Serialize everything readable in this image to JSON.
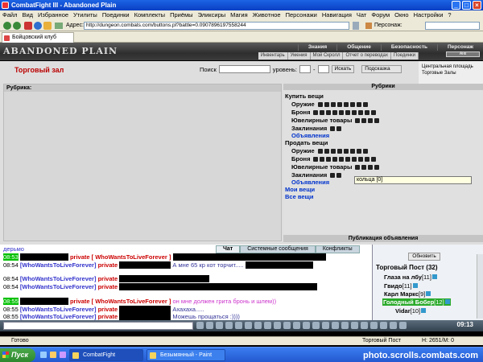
{
  "window": {
    "title": "CombatFight III - Abandoned Plain"
  },
  "menu": [
    "Файл",
    "Вид",
    "Избранное",
    "Утилиты",
    "Поединки",
    "Комплекты",
    "Приёмы",
    "Эликсиры",
    "Магия",
    "Животное",
    "Персонажи",
    "Навигация",
    "Чат",
    "Форум",
    "Окно",
    "Настройки",
    "?"
  ],
  "address": {
    "label": "Адрес:",
    "url": "http://dungeon.combats.com/buttons.pl?battle=0.0907896197558244",
    "persona_label": "Персонаж:"
  },
  "tab": {
    "label": "Бойцовский клуб"
  },
  "banner": {
    "logo": "ABANDONED PLAIN",
    "tabs": [
      "Знания",
      "Общение",
      "Безопасность",
      "Персонаж"
    ],
    "subnav": [
      "Инвентарь",
      "Умения",
      "Мой Скролл",
      "Отчет о переводах",
      "Поединки",
      "Анк"
    ]
  },
  "locations": [
    "Центральная площадь",
    "Торговые Залы"
  ],
  "hall": {
    "title": "Торговый зал",
    "search_label": "Поиск",
    "level_label": "уровень:",
    "level_sep": "-",
    "search_btn": "Искать",
    "hint_btn": "Подсказка"
  },
  "left_header": "Рубрика:",
  "right_header": "Рубрики",
  "buy": {
    "title": "Купить вещи",
    "cats": [
      "Оружие",
      "Броня",
      "Ювелирные товары",
      "Заклинания"
    ],
    "ads": "Объявления"
  },
  "sell": {
    "title": "Продать вещи",
    "cats": [
      "Оружие",
      "Броня",
      "Ювелирные товары",
      "Заклинания"
    ],
    "ads": "Объявления"
  },
  "my_items": "Мои вещи",
  "all_items": "Все вещи",
  "tooltip": "кольца [0]",
  "publish": "Публикация объявления",
  "chat_tabs": [
    "Чат",
    "Системные сообщения",
    "Конфликты"
  ],
  "chat": {
    "first": "дерьмо",
    "lines": [
      {
        "time": "08:53",
        "hl": true,
        "private": "private [ WhoWantsToLiveForever ]",
        "msg": ""
      },
      {
        "time": "08:54",
        "nick": "[WhoWantsToLiveForever]",
        "private": "private",
        "msg": "А мне 65 кр кот торчит.....",
        "style": "msg"
      },
      {
        "time": "08:54",
        "nick": "[WhoWantsToLiveForever]",
        "private": "private",
        "msg": "",
        "style": "msg"
      },
      {
        "time": "08:54",
        "nick": "[WhoWantsToLiveForever]",
        "private": "private",
        "msg": "",
        "style": "msg"
      },
      {
        "time": "08:55",
        "hl": true,
        "private": "private [ WhoWantsToLiveForever ]",
        "msg": "он мне должен грита бронь и шлем))",
        "style": "msg2"
      },
      {
        "time": "08:55",
        "nick": "[WhoWantsToLiveForever]",
        "private": "private",
        "msg": "Ахахаха.....",
        "style": "msg"
      },
      {
        "time": "08:55",
        "nick": "[WhoWantsToLiveForever]",
        "private": "private",
        "msg": "Можешь прощаться :))))",
        "style": "msg"
      }
    ]
  },
  "post": {
    "refresh": "Обновить",
    "title": "Торговый Пост",
    "count": "(32)",
    "players": [
      {
        "name": "Глаза на лбу",
        "level": "[11]"
      },
      {
        "name": "Гвидо",
        "level": "[11]"
      },
      {
        "name": "Карл Маркс",
        "level": "[9]"
      },
      {
        "name": "Голодный Бобер",
        "level": "[12]",
        "bober": true
      },
      {
        "name": "Vidar",
        "level": "[10]"
      }
    ]
  },
  "clock": "09:13",
  "status": {
    "left": "Готово",
    "mid": "Торговый Пост",
    "right": "H: 2651/M: 0"
  },
  "taskbar": {
    "start": "Пуск",
    "items": [
      "CombatFight",
      "Безымянный - Paint"
    ]
  },
  "watermark": "photo.scrolls.combats.com"
}
